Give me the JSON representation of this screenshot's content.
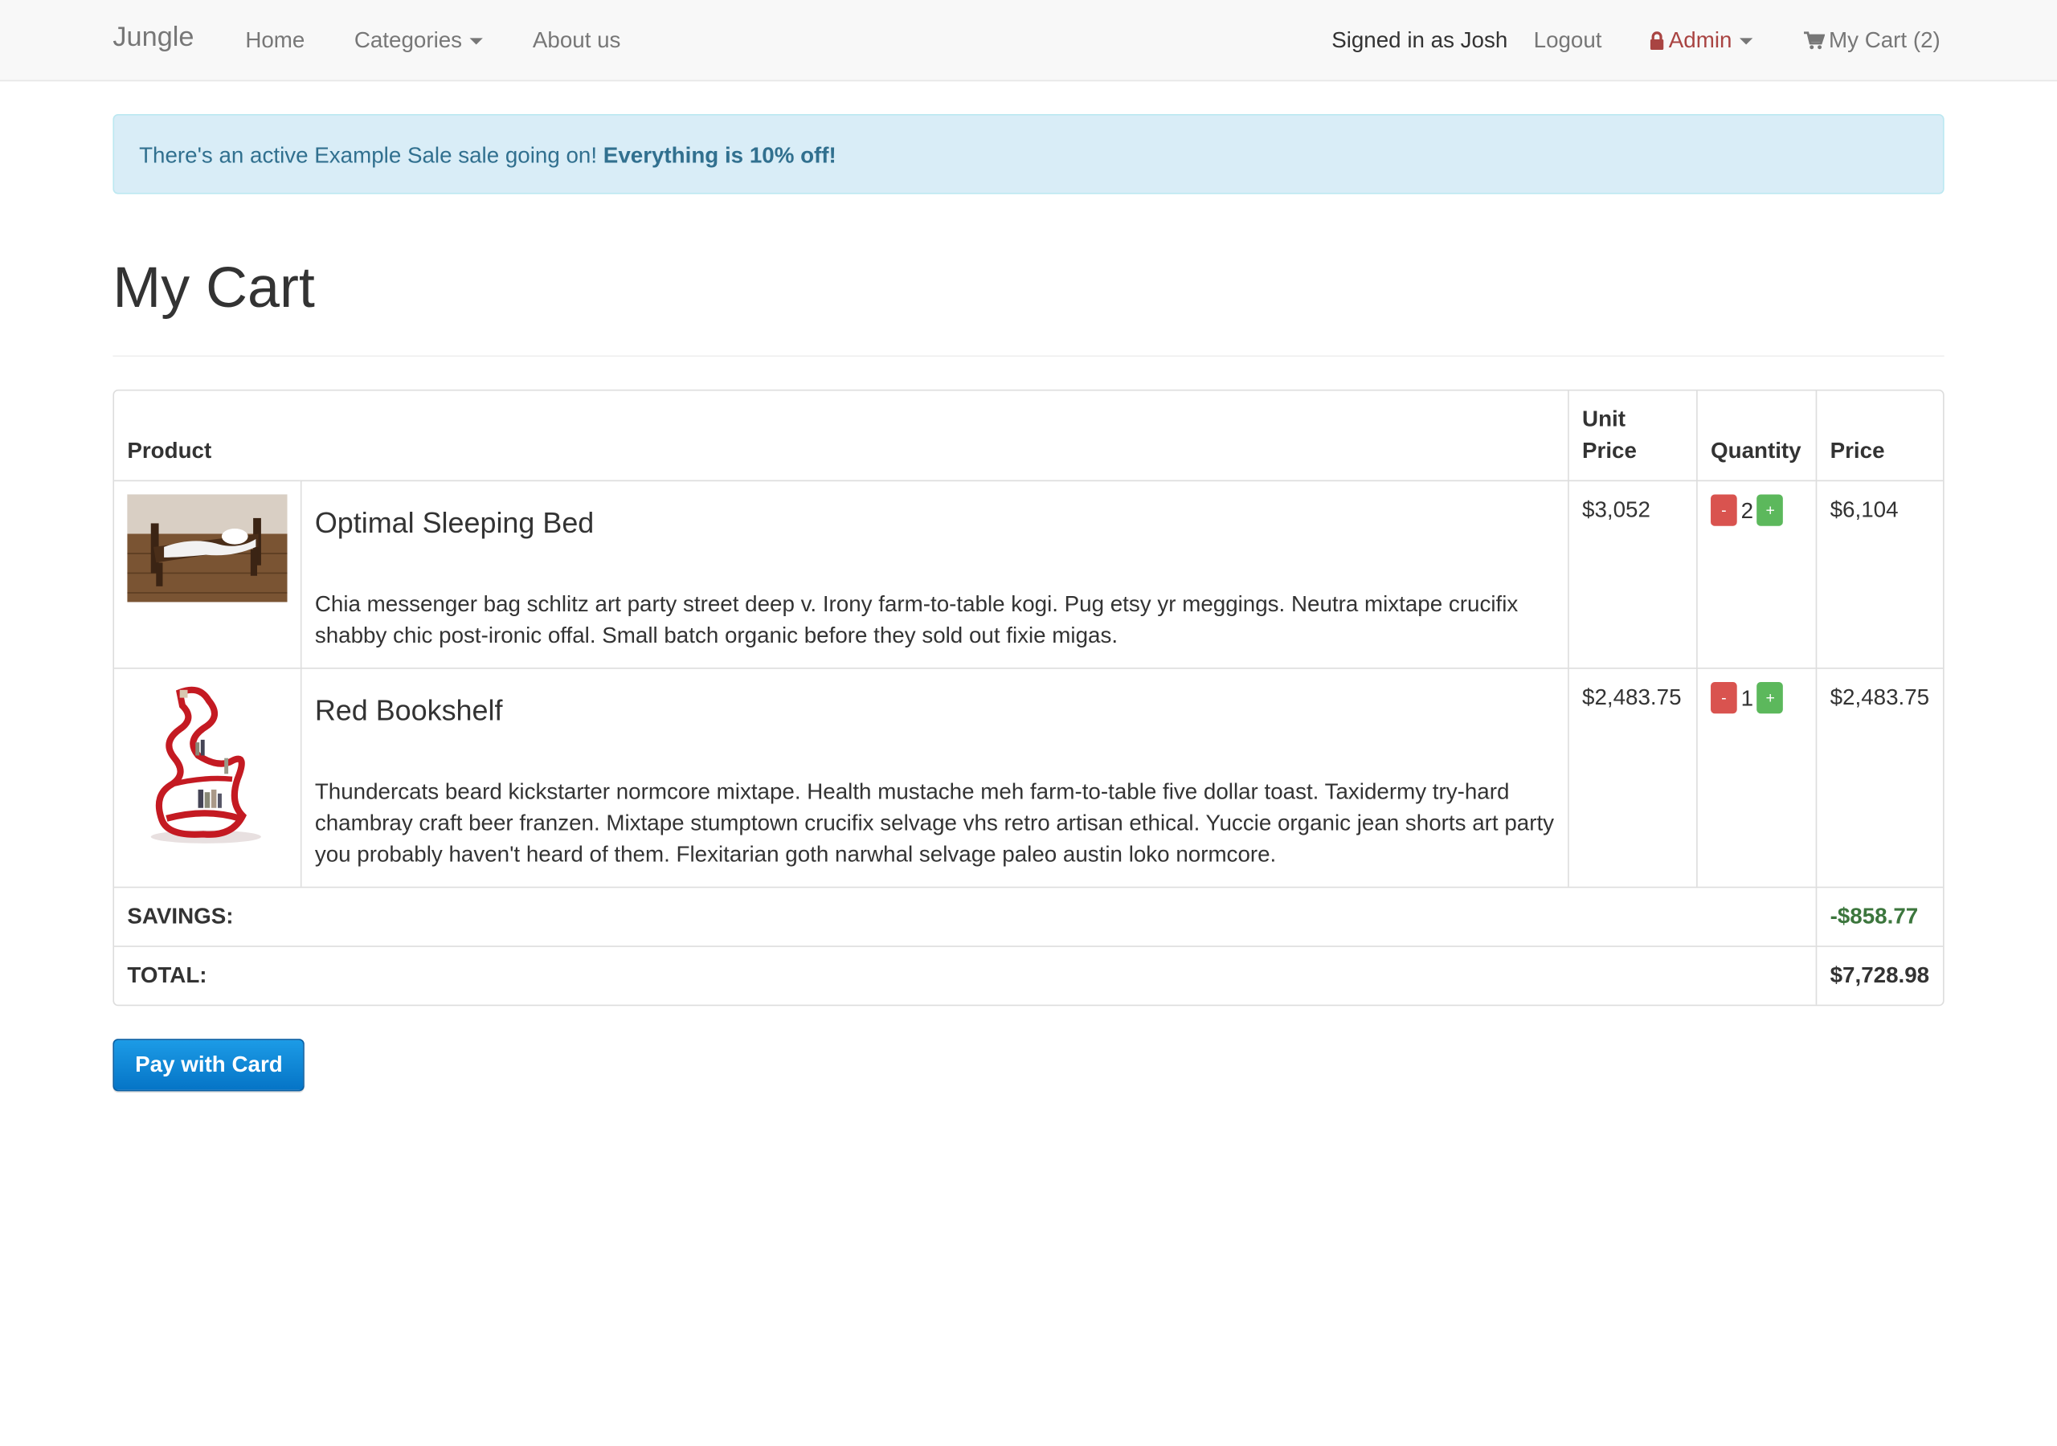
{
  "navbar": {
    "brand": "Jungle",
    "links": {
      "home": "Home",
      "categories": "Categories",
      "about": "About us"
    },
    "signed_in": "Signed in as Josh",
    "logout": "Logout",
    "admin": "Admin",
    "cart": "My Cart (2)"
  },
  "alert": {
    "text": "There's an active Example Sale sale going on!",
    "emphasis": "Everything is 10% off!"
  },
  "page_title": "My Cart",
  "table": {
    "headers": {
      "product": "Product",
      "unit_price": "Unit Price",
      "quantity": "Quantity",
      "price": "Price"
    },
    "items": [
      {
        "name": "Optimal Sleeping Bed",
        "description": "Chia messenger bag schlitz art party street deep v. Irony farm-to-table kogi. Pug etsy yr meggings. Neutra mixtape crucifix shabby chic post-ironic offal. Small batch organic before they sold out fixie migas.",
        "unit_price": "$3,052",
        "quantity": "2",
        "price": "$6,104",
        "minus": "-",
        "plus": "+"
      },
      {
        "name": "Red Bookshelf",
        "description": "Thundercats beard kickstarter normcore mixtape. Health mustache meh farm-to-table five dollar toast. Taxidermy try-hard chambray craft beer franzen. Mixtape stumptown crucifix selvage vhs retro artisan ethical. Yuccie organic jean shorts art party you probably haven't heard of them. Flexitarian goth narwhal selvage paleo austin loko normcore.",
        "unit_price": "$2,483.75",
        "quantity": "1",
        "price": "$2,483.75",
        "minus": "-",
        "plus": "+"
      }
    ],
    "savings_label": "SAVINGS:",
    "savings_value": "-$858.77",
    "total_label": "TOTAL:",
    "total_value": "$7,728.98"
  },
  "pay_button": "Pay with Card",
  "colors": {
    "alert_bg": "#d9edf7",
    "alert_text": "#31708f",
    "admin": "#a94442",
    "minus_btn": "#d9534f",
    "plus_btn": "#5cb85c",
    "savings": "#3c763d",
    "pay_btn": "#1c9be6"
  }
}
